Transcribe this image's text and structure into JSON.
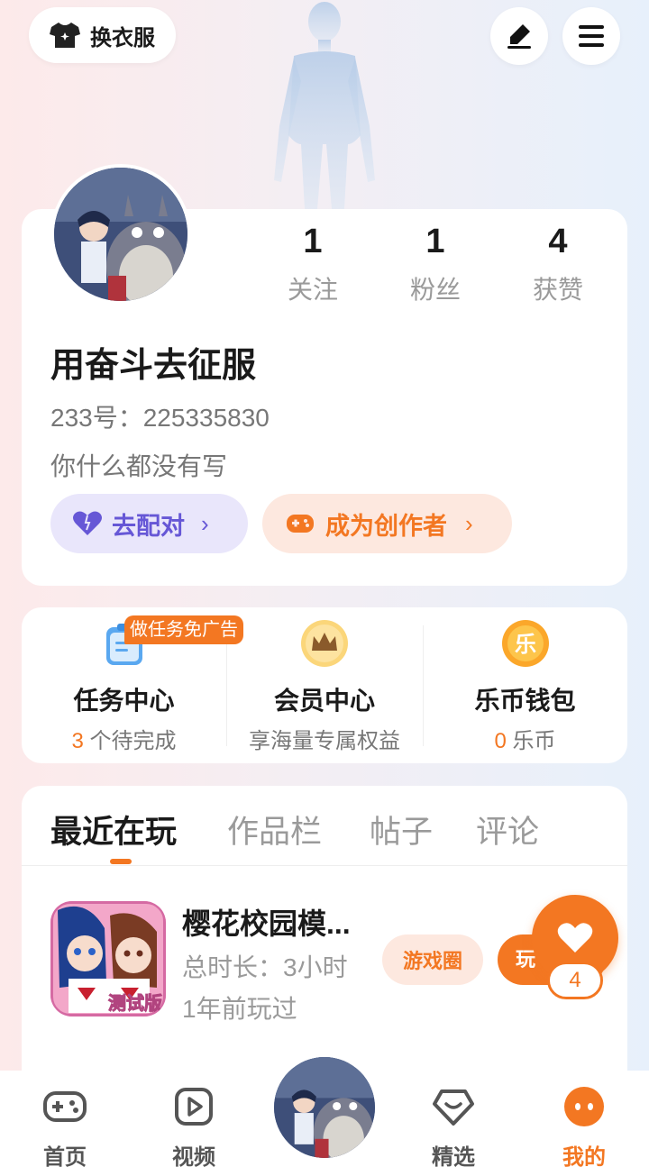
{
  "header": {
    "outfit_label": "换衣服",
    "edit_icon": "edit-pen-icon",
    "menu_icon": "menu-icon"
  },
  "profile": {
    "stats": [
      {
        "value": "1",
        "label": "关注"
      },
      {
        "value": "1",
        "label": "粉丝"
      },
      {
        "value": "4",
        "label": "获赞"
      }
    ],
    "username": "用奋斗去征服",
    "id_text": "233号：225335830",
    "bio": "你什么都没有写",
    "match_label": "去配对",
    "creator_label": "成为创作者"
  },
  "services": {
    "badge": "做任务免广告",
    "items": [
      {
        "title": "任务中心",
        "count": "3",
        "sub": " 个待完成"
      },
      {
        "title": "会员中心",
        "sub": "享海量专属权益"
      },
      {
        "title": "乐币钱包",
        "count": "0",
        "sub": " 乐币",
        "coin_char": "乐"
      }
    ]
  },
  "tabs": [
    "最近在玩",
    "作品栏",
    "帖子",
    "评论"
  ],
  "game": {
    "name": "樱花校园模...",
    "duration": "总时长：3小时",
    "last_played": "1年前玩过",
    "circle_label": "游戏圈",
    "play_label": "玩",
    "icon_badge": "测试版",
    "like_count": "4"
  },
  "nav": [
    {
      "label": "首页"
    },
    {
      "label": "视频"
    },
    {
      "label": "精选"
    },
    {
      "label": "我的"
    }
  ],
  "colors": {
    "accent": "#f37722",
    "purple": "#6657d6"
  }
}
